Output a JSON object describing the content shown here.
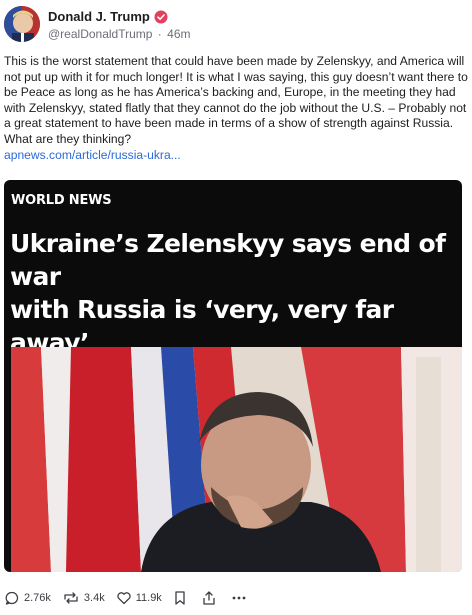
{
  "author": {
    "display_name": "Donald J. Trump",
    "handle": "@realDonaldTrump",
    "separator": "·",
    "time_ago": "46m"
  },
  "post": {
    "text": "This is the worst statement that could have been made by Zelenskyy, and America will not put up with it for much longer! It is what I was saying, this guy doesn’t want there to be Peace as long as he has America’s backing and, Europe, in the meeting they had with Zelenskyy, stated flatly that they cannot do the job without the U.S. – Probably not a great statement to have been made in terms of a show of strength against Russia. What are they thinking?",
    "link": "apnews.com/article/russia-ukra..."
  },
  "card": {
    "kicker": "WORLD NEWS",
    "headline_line1": "Ukraine’s Zelenskyy says end of war",
    "headline_line2": "with Russia is ‘very, very far away’"
  },
  "actions": {
    "replies": "2.76k",
    "reposts": "3.4k",
    "likes": "11.9k"
  },
  "icons": {
    "reply": "reply-icon",
    "repost": "repost-icon",
    "like": "heart-icon",
    "bookmark": "bookmark-icon",
    "share": "share-icon",
    "more": "more-icon",
    "verified": "verified-badge-icon"
  },
  "colors": {
    "link": "#2b6ad8",
    "verified": "#e2405f",
    "card_bg": "#0b0b0b"
  }
}
